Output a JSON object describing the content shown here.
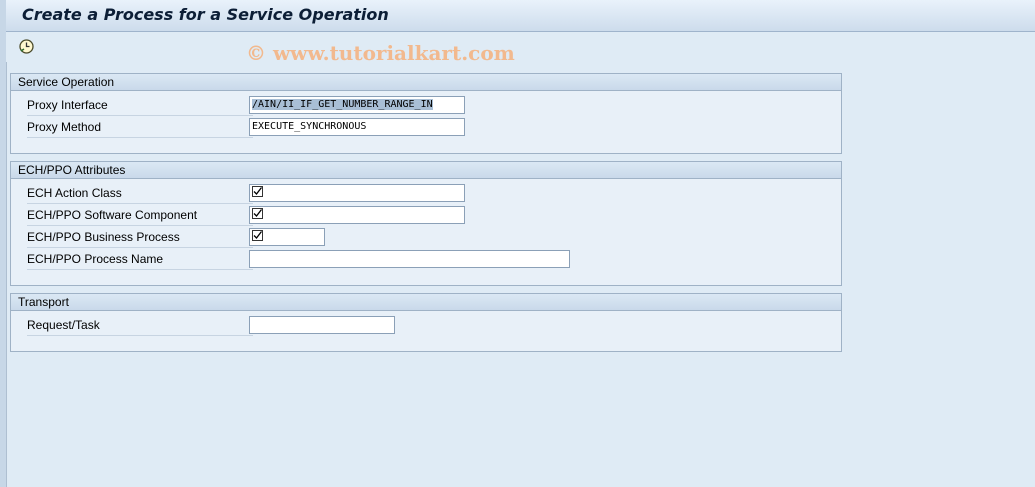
{
  "window": {
    "title": "Create a Process for a Service Operation"
  },
  "toolbar": {
    "execute_icon": "execute-clock-icon"
  },
  "watermark": "© www.tutorialkart.com",
  "service_operation": {
    "header": "Service Operation",
    "proxy_interface": {
      "label": "Proxy Interface",
      "value": "/AIN/II_IF_GET_NUMBER_RANGE_IN"
    },
    "proxy_method": {
      "label": "Proxy Method",
      "value": "EXECUTE_SYNCHRONOUS"
    }
  },
  "ech_ppo": {
    "header": "ECH/PPO Attributes",
    "action_class": {
      "label": "ECH Action Class",
      "value": "",
      "required_icon": "required-check-icon"
    },
    "software_component": {
      "label": "ECH/PPO Software Component",
      "value": "",
      "required_icon": "required-check-icon"
    },
    "business_process": {
      "label": "ECH/PPO Business Process",
      "value": "",
      "required_icon": "required-check-icon"
    },
    "process_name": {
      "label": "ECH/PPO Process Name",
      "value": ""
    }
  },
  "transport": {
    "header": "Transport",
    "request_task": {
      "label": "Request/Task",
      "value": ""
    }
  }
}
